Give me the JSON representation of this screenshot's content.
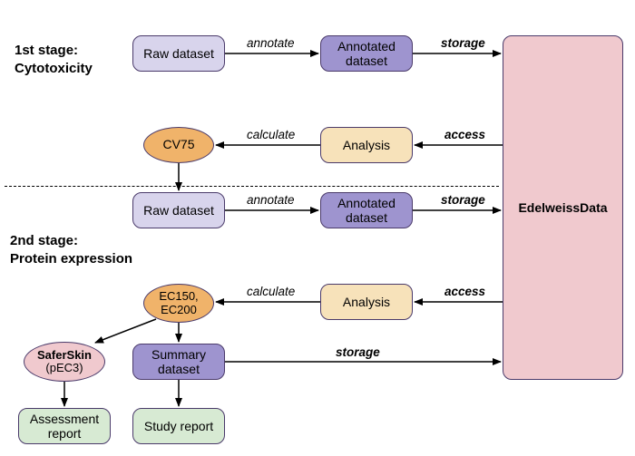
{
  "stages": {
    "s1": {
      "line1": "1st stage:",
      "line2": "Cytotoxicity"
    },
    "s2": {
      "line1": "2nd stage:",
      "line2": "Protein expression"
    }
  },
  "nodes": {
    "raw1": "Raw dataset",
    "annot1": "Annotated\ndataset",
    "analysis1": "Analysis",
    "cv75": "CV75",
    "raw2": "Raw dataset",
    "annot2": "Annotated\ndataset",
    "analysis2": "Analysis",
    "ec": "EC150,\nEC200",
    "saferskin_line1": "SaferSkin",
    "saferskin_line2": "(pEC3)",
    "summary": "Summary\ndataset",
    "assessment": "Assessment\nreport",
    "study": "Study report",
    "edelweiss": "EdelweissData"
  },
  "edges": {
    "annotate": "annotate",
    "storage": "storage",
    "access": "access",
    "calculate": "calculate"
  }
}
